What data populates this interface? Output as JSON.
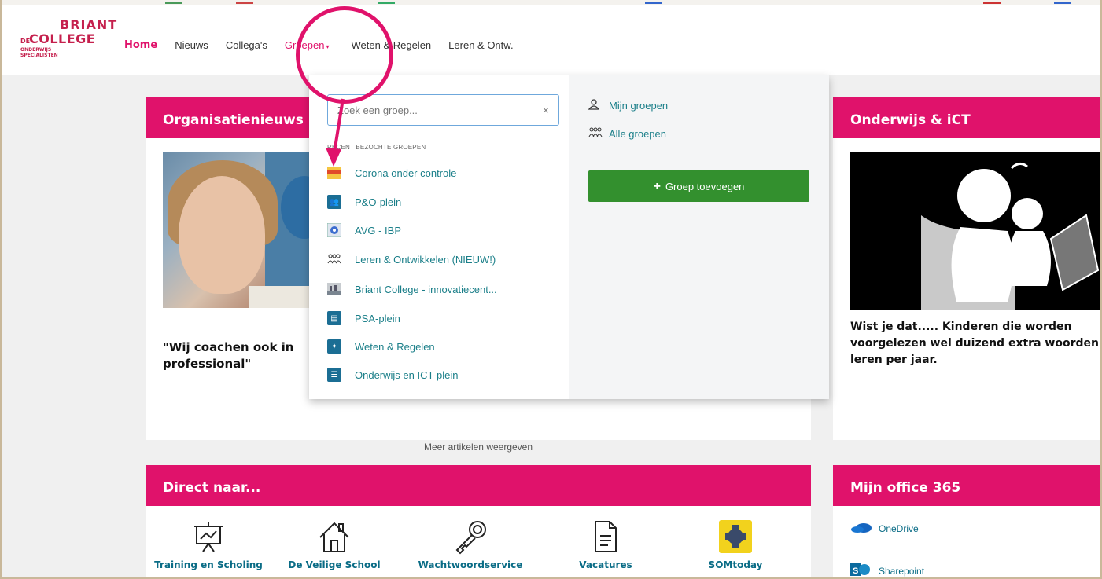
{
  "logo": {
    "line1": "BRIANT",
    "prefix": "DE",
    "line2": "COLLEGE",
    "line3a": "ONDERWIJS",
    "line3b": "SPECIALISTEN"
  },
  "nav": {
    "home": "Home",
    "news": "Nieuws",
    "colleagues": "Collega's",
    "groups": "Groepen",
    "groups_caret": "▾",
    "rules": "Weten & Regelen",
    "learn": "Leren & Ontw."
  },
  "dropdown": {
    "search_placeholder": "Zoek een groep...",
    "clear": "×",
    "recent_label": "RECENT BEZOCHTE GROEPEN",
    "groups": [
      {
        "label": "Corona onder controle",
        "icon": "corona-group-icon"
      },
      {
        "label": "P&O-plein",
        "icon": "people-group-icon"
      },
      {
        "label": "AVG - IBP",
        "icon": "avg-group-icon"
      },
      {
        "label": "Leren & Ontwikkelen (NIEUW!)",
        "icon": "group-outline-icon"
      },
      {
        "label": "Briant College - innovatiecent...",
        "icon": "building-group-icon"
      },
      {
        "label": "PSA-plein",
        "icon": "psa-group-icon"
      },
      {
        "label": "Weten & Regelen",
        "icon": "rules-group-icon"
      },
      {
        "label": "Onderwijs en ICT-plein",
        "icon": "ict-group-icon"
      }
    ],
    "my_groups": "Mijn groepen",
    "all_groups": "Alle groepen",
    "add_group": "Groep toevoegen"
  },
  "cards": {
    "news": {
      "title": "Organisatienieuws",
      "article_title": "\"Wij coachen ook in de rol van professional\"",
      "article_title_visible": "\"Wij coachen ook in professional\"",
      "more": "Meer artikelen weergeven"
    },
    "ict": {
      "title": "Onderwijs & iCT",
      "text_line1": "Wist je dat..... Kinderen die worden",
      "text_line2": "voorgelezen wel duizend extra woorden",
      "text_line3": "leren per jaar."
    },
    "direct": {
      "title": "Direct naar...",
      "items": [
        "Training en Scholing",
        "De Veilige School",
        "Wachtwoordservice",
        "Vacatures",
        "SOMtoday"
      ]
    },
    "office": {
      "title": "Mijn office 365",
      "items": [
        "OneDrive",
        "Sharepoint"
      ]
    }
  },
  "colors": {
    "accent": "#e0126b",
    "link": "#1b7f89",
    "button": "#33902e"
  }
}
